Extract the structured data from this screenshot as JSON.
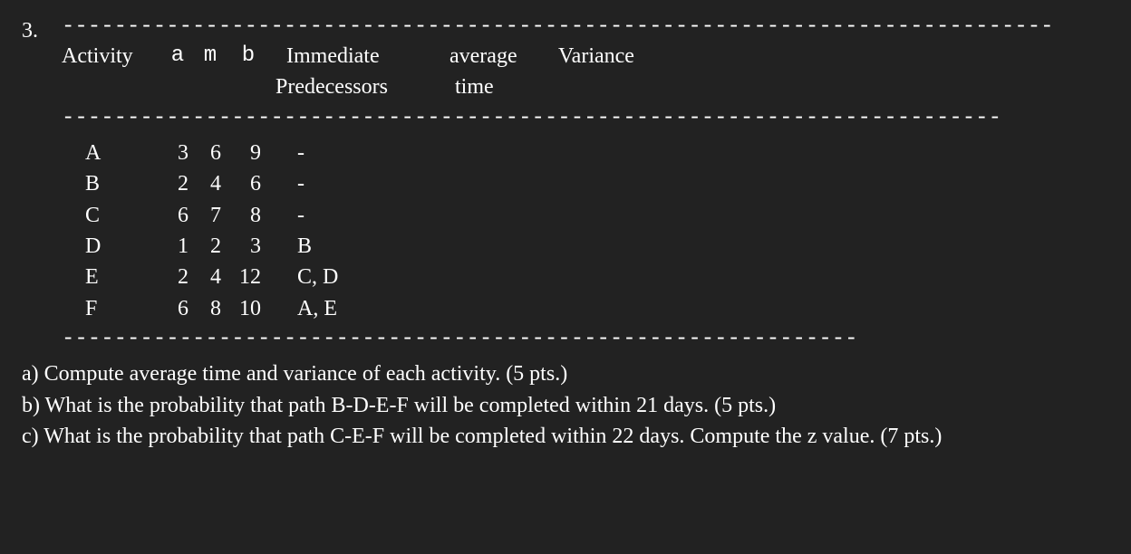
{
  "problem_number": "3.",
  "dashes": {
    "top": "----------------------------------------------------------------------------",
    "mid": "------------------------------------------------------------------------",
    "bottom": "-------------------------------------------------------------"
  },
  "headers": {
    "activity": "Activity",
    "a": "a",
    "m": "m",
    "b": "b",
    "pred1": "Immediate",
    "pred2": "Predecessors",
    "avg1": "average",
    "avg2": "time",
    "var": "Variance"
  },
  "rows": [
    {
      "activity": "A",
      "a": "3",
      "m": "6",
      "b": "9",
      "pred": "-"
    },
    {
      "activity": "B",
      "a": "2",
      "m": "4",
      "b": "6",
      "pred": "-"
    },
    {
      "activity": "C",
      "a": "6",
      "m": "7",
      "b": "8",
      "pred": "-"
    },
    {
      "activity": "D",
      "a": "1",
      "m": "2",
      "b": "3",
      "pred": "B"
    },
    {
      "activity": "E",
      "a": "2",
      "m": "4",
      "b": "12",
      "pred": "C, D"
    },
    {
      "activity": "F",
      "a": "6",
      "m": "8",
      "b": "10",
      "pred": "A, E"
    }
  ],
  "questions": {
    "a": "a) Compute average time and variance of each activity. (5 pts.)",
    "b": "b) What is the probability that path B-D-E-F will be completed within 21 days. (5 pts.)",
    "c": "c) What is the probability that path C-E-F will be completed within 22 days. Compute the z value. (7 pts.)"
  }
}
